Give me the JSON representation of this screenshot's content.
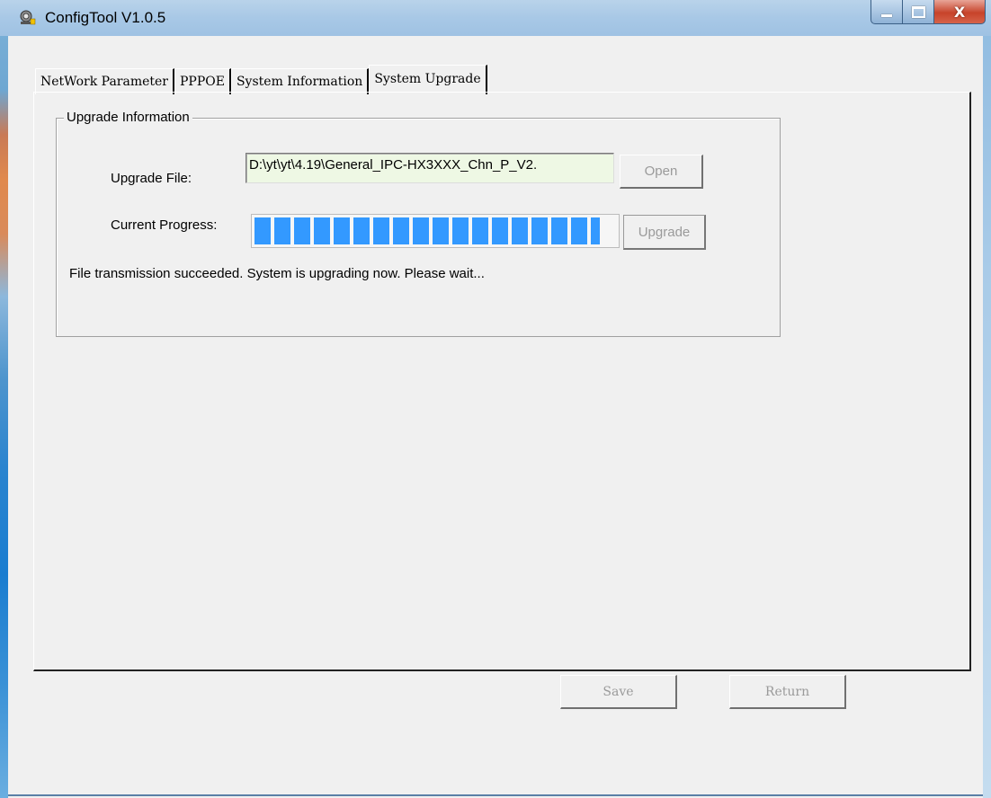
{
  "window": {
    "title": "ConfigTool V1.0.5",
    "icon": "camera-icon",
    "controls": [
      "minimize-icon",
      "maximize-icon",
      "close-icon"
    ],
    "close_glyph": "X"
  },
  "tabs": [
    {
      "label": "NetWork Parameter",
      "active": false
    },
    {
      "label": "PPPOE",
      "active": false
    },
    {
      "label": "System Information",
      "active": false
    },
    {
      "label": "System Upgrade",
      "active": true
    }
  ],
  "upgrade": {
    "group_title": "Upgrade Information",
    "file_label": "Upgrade File:",
    "file_value": "D:\\yt\\yt\\4.19\\General_IPC-HX3XXX_Chn_P_V2.",
    "open_button": "Open",
    "progress_label": "Current Progress:",
    "progress_percent": 100,
    "upgrade_button": "Upgrade",
    "status": "File transmission succeeded. System is upgrading now. Please wait..."
  },
  "footer": {
    "save_button": "Save",
    "return_button": "Return"
  },
  "colors": {
    "progress": "#3399ff",
    "file_field_bg": "#eef8e4",
    "close_button": "#c7432a"
  }
}
